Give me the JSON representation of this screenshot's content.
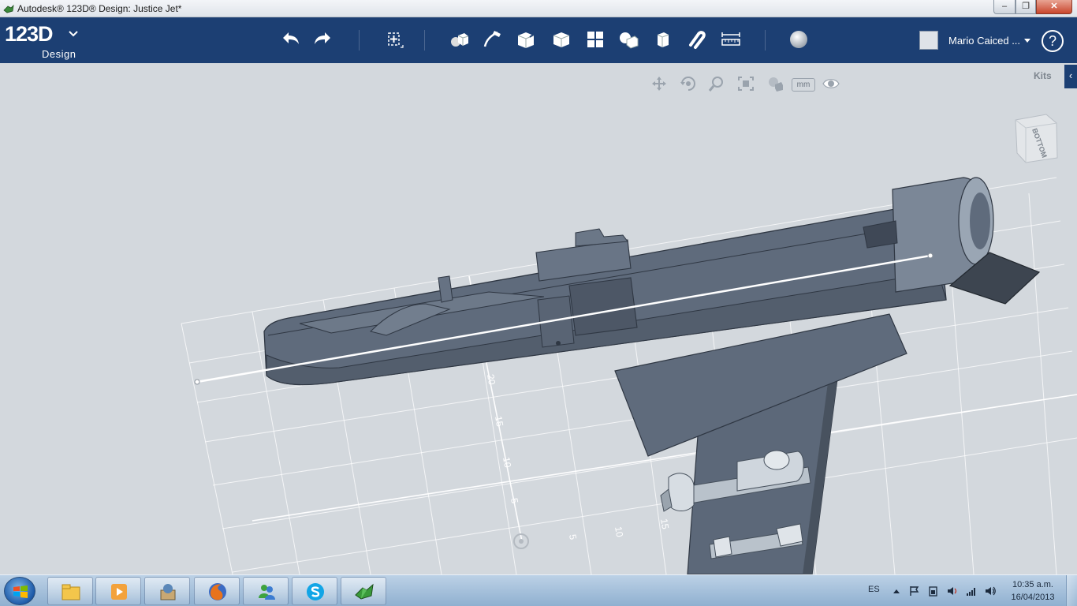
{
  "window": {
    "title": "Autodesk® 123D® Design: Justice Jet*",
    "min_glyph": "–",
    "max_glyph": "❐",
    "close_glyph": "✕"
  },
  "app": {
    "logo_main": "123D",
    "logo_sub": "Design"
  },
  "toolbar": {
    "tools": [
      {
        "name": "undo-icon"
      },
      {
        "name": "redo-icon"
      },
      {
        "name": "transform-icon"
      },
      {
        "name": "primitives-icon"
      },
      {
        "name": "sketch-icon"
      },
      {
        "name": "construct-icon"
      },
      {
        "name": "modify-icon"
      },
      {
        "name": "pattern-icon"
      },
      {
        "name": "grouping-icon"
      },
      {
        "name": "combine-icon"
      },
      {
        "name": "snap-icon"
      },
      {
        "name": "measure-icon"
      },
      {
        "name": "material-icon"
      }
    ],
    "user_name": "Mario Caiced ...",
    "help_glyph": "?"
  },
  "view_tools": [
    "pan-icon",
    "orbit-icon",
    "zoom-icon",
    "fit-icon",
    "visual-style-icon",
    "units-icon",
    "visibility-icon"
  ],
  "units_label": "mm",
  "kits": {
    "label": "Kits",
    "collapse_glyph": "‹"
  },
  "viewcube": {
    "face_label": "BOTTOM"
  },
  "grid_labels": [
    "25",
    "20",
    "15",
    "10",
    "5",
    "5",
    "10",
    "15",
    "20",
    "25"
  ],
  "taskbar": {
    "language": "ES",
    "time": "10:35 a.m.",
    "date": "16/04/2013",
    "apps": [
      "explorer-icon",
      "media-player-icon",
      "program-icon",
      "firefox-icon",
      "messenger-icon",
      "skype-icon",
      "123d-design-icon"
    ]
  },
  "colors": {
    "toolbar_bg": "#1c3f73",
    "viewport_bg": "#d3d8dd",
    "model_fill": "#5f6b7c",
    "model_dark": "#3f4856",
    "grid_line": "#ffffff"
  }
}
